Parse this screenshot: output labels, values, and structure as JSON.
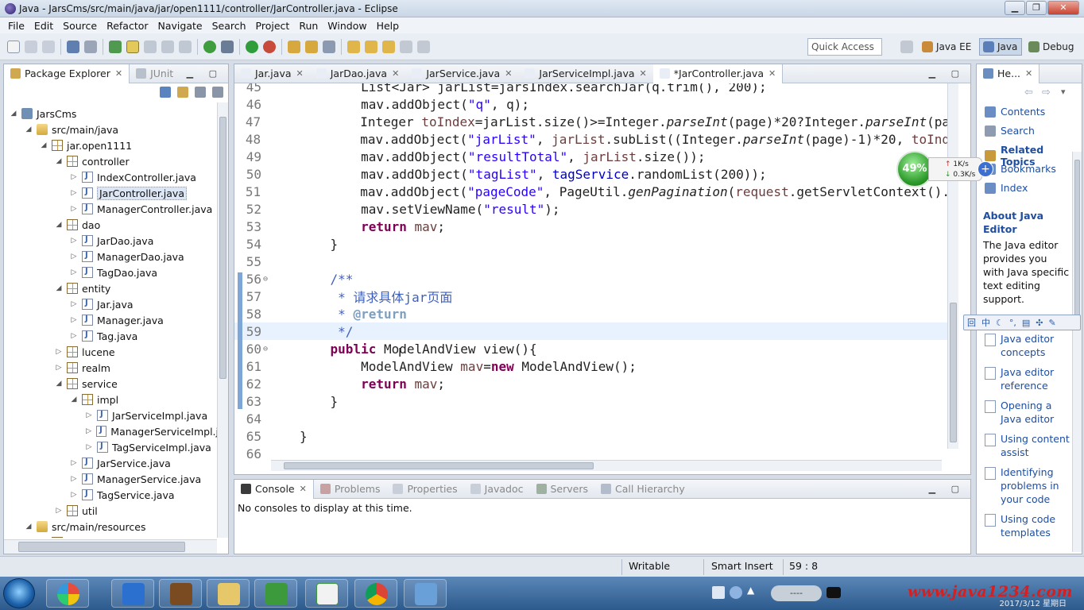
{
  "window": {
    "title": "Java - JarsCms/src/main/java/jar/open1111/controller/JarController.java - Eclipse",
    "buttons": {
      "minimize": "▁",
      "restore": "❐",
      "close": "✕"
    }
  },
  "menubar": [
    "File",
    "Edit",
    "Source",
    "Refactor",
    "Navigate",
    "Search",
    "Project",
    "Run",
    "Window",
    "Help"
  ],
  "toolbar": {
    "quick_access": "Quick Access",
    "perspectives": [
      {
        "label": "Java EE",
        "active": false
      },
      {
        "label": "Java",
        "active": true
      },
      {
        "label": "Debug",
        "active": false
      }
    ]
  },
  "package_explorer": {
    "tabs": [
      {
        "label": "Package Explorer",
        "active": true
      },
      {
        "label": "JUnit",
        "active": false
      }
    ],
    "tree": [
      {
        "depth": 0,
        "twisty": "◢",
        "icon": "project",
        "label": "JarsCms"
      },
      {
        "depth": 1,
        "twisty": "◢",
        "icon": "srcfolder",
        "label": "src/main/java"
      },
      {
        "depth": 2,
        "twisty": "◢",
        "icon": "pkg",
        "label": "jar.open1111"
      },
      {
        "depth": 3,
        "twisty": "◢",
        "icon": "pkg",
        "label": "controller"
      },
      {
        "depth": 4,
        "twisty": "▷",
        "icon": "java",
        "label": "IndexController.java"
      },
      {
        "depth": 4,
        "twisty": "▷",
        "icon": "java",
        "label": "JarController.java",
        "selected": true
      },
      {
        "depth": 4,
        "twisty": "▷",
        "icon": "java",
        "label": "ManagerController.java"
      },
      {
        "depth": 3,
        "twisty": "◢",
        "icon": "pkg",
        "label": "dao"
      },
      {
        "depth": 4,
        "twisty": "▷",
        "icon": "java",
        "label": "JarDao.java"
      },
      {
        "depth": 4,
        "twisty": "▷",
        "icon": "java",
        "label": "ManagerDao.java"
      },
      {
        "depth": 4,
        "twisty": "▷",
        "icon": "java",
        "label": "TagDao.java"
      },
      {
        "depth": 3,
        "twisty": "◢",
        "icon": "pkg",
        "label": "entity"
      },
      {
        "depth": 4,
        "twisty": "▷",
        "icon": "java",
        "label": "Jar.java"
      },
      {
        "depth": 4,
        "twisty": "▷",
        "icon": "java",
        "label": "Manager.java"
      },
      {
        "depth": 4,
        "twisty": "▷",
        "icon": "java",
        "label": "Tag.java"
      },
      {
        "depth": 3,
        "twisty": "▷",
        "icon": "pkg",
        "label": "lucene"
      },
      {
        "depth": 3,
        "twisty": "▷",
        "icon": "pkg",
        "label": "realm"
      },
      {
        "depth": 3,
        "twisty": "◢",
        "icon": "pkg",
        "label": "service"
      },
      {
        "depth": 4,
        "twisty": "◢",
        "icon": "pkg",
        "label": "impl"
      },
      {
        "depth": 5,
        "twisty": "▷",
        "icon": "java",
        "label": "JarServiceImpl.java"
      },
      {
        "depth": 5,
        "twisty": "▷",
        "icon": "java",
        "label": "ManagerServiceImpl.j"
      },
      {
        "depth": 5,
        "twisty": "▷",
        "icon": "java",
        "label": "TagServiceImpl.java"
      },
      {
        "depth": 4,
        "twisty": "▷",
        "icon": "java",
        "label": "JarService.java"
      },
      {
        "depth": 4,
        "twisty": "▷",
        "icon": "java",
        "label": "ManagerService.java"
      },
      {
        "depth": 4,
        "twisty": "▷",
        "icon": "java",
        "label": "TagService.java"
      },
      {
        "depth": 3,
        "twisty": "▷",
        "icon": "pkg",
        "label": "util"
      },
      {
        "depth": 1,
        "twisty": "◢",
        "icon": "srcfolder",
        "label": "src/main/resources"
      },
      {
        "depth": 2,
        "twisty": "◢",
        "icon": "pkg",
        "label": "jar"
      }
    ]
  },
  "editor": {
    "tabs": [
      {
        "label": "Jar.java",
        "active": false
      },
      {
        "label": "JarDao.java",
        "active": false
      },
      {
        "label": "JarService.java",
        "active": false
      },
      {
        "label": "JarServiceImpl.java",
        "active": false
      },
      {
        "label": "*JarController.java",
        "active": true
      }
    ],
    "current_line": 59,
    "lines": [
      {
        "n": "45",
        "html": "        List&lt;Jar&gt; jarList=jarsIndex.searchJar(q.trim(), 200);"
      },
      {
        "n": "46",
        "html": "        mav.addObject(<span class='str'>\"q\"</span>, q);"
      },
      {
        "n": "47",
        "html": "        Integer <span class='var'>toIndex</span>=jarList.size()&gt;=Integer.<span class='it'>parseInt</span>(page)*20?Integer.<span class='it'>parseInt</span>(pa"
      },
      {
        "n": "48",
        "html": "        mav.addObject(<span class='str'>\"jarList\"</span>, <span class='var'>jarList</span>.subList((Integer.<span class='it'>parseInt</span>(page)-1)*20, <span class='var'>toInd</span>"
      },
      {
        "n": "49",
        "html": "        mav.addObject(<span class='str'>\"resultTotal\"</span>, <span class='var'>jarList</span>.size());"
      },
      {
        "n": "50",
        "html": "        mav.addObject(<span class='str'>\"tagList\"</span>, <span class='fld'>tagService</span>.randomList(200));"
      },
      {
        "n": "51",
        "html": "        mav.addObject(<span class='str'>\"pageCode\"</span>, PageUtil.<span class='it'>genPagination</span>(<span class='var'>request</span>.getServletContext()."
      },
      {
        "n": "52",
        "html": "        mav.setViewName(<span class='str'>\"result\"</span>);"
      },
      {
        "n": "53",
        "html": "        <span class='kw'>return</span> <span class='var'>mav</span>;"
      },
      {
        "n": "54",
        "html": "    }"
      },
      {
        "n": "55",
        "html": ""
      },
      {
        "n": "56",
        "html": "    <span class='com'>/**</span>",
        "fold": "⊖"
      },
      {
        "n": "57",
        "html": "<span class='com'>     * 请求具体jar页面</span>"
      },
      {
        "n": "58",
        "html": "<span class='com'>     * </span><span class='tag'>@return</span>"
      },
      {
        "n": "59",
        "html": "<span class='com'>     */</span>"
      },
      {
        "n": "60",
        "html": "    <span class='kw'>public</span> ModelAndView view(){",
        "fold": "⊖"
      },
      {
        "n": "61",
        "html": "        ModelAndView <span class='var'>mav</span>=<span class='kw'>new</span> ModelAndView();"
      },
      {
        "n": "62",
        "html": "        <span class='kw'>return</span> <span class='var'>mav</span>;"
      },
      {
        "n": "63",
        "html": "    }"
      },
      {
        "n": "64",
        "html": ""
      },
      {
        "n": "65",
        "html": "}"
      },
      {
        "n": "66",
        "html": ""
      }
    ]
  },
  "console": {
    "tabs": [
      {
        "label": "Console",
        "active": true
      },
      {
        "label": "Problems",
        "active": false
      },
      {
        "label": "Properties",
        "active": false
      },
      {
        "label": "Javadoc",
        "active": false
      },
      {
        "label": "Servers",
        "active": false
      },
      {
        "label": "Call Hierarchy",
        "active": false
      }
    ],
    "message": "No consoles to display at this time."
  },
  "help": {
    "tab_label": "He...",
    "links": [
      "Contents",
      "Search",
      "Related Topics",
      "Bookmarks",
      "Index"
    ],
    "about_heading": "About Java Editor",
    "about_text": "The Java editor provides you with Java specific text editing support.",
    "topics": [
      "Java editor concepts",
      "Java editor reference",
      "Opening a Java editor",
      "Using content assist",
      "Identifying problems in your code",
      "Using code templates"
    ]
  },
  "net_widget": {
    "percent": "49%",
    "up": "1K/s",
    "down": "0.3K/s"
  },
  "statusbar": {
    "writable": "Writable",
    "insert_mode": "Smart Insert",
    "position": "59 : 8"
  },
  "taskbar": {
    "watermark": "www.java1234.com",
    "date": "2017/3/12 星期日",
    "tray_box": "----"
  }
}
